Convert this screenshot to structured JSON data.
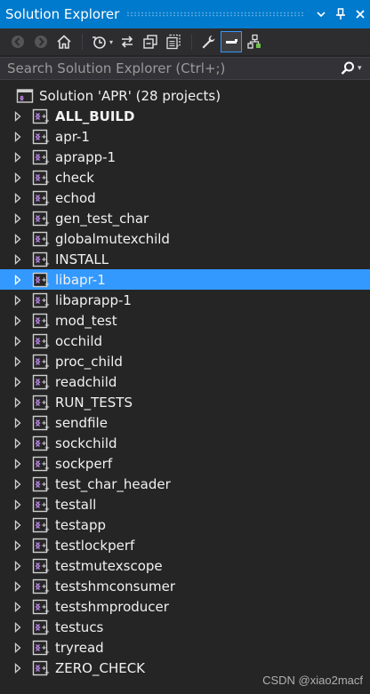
{
  "window": {
    "title": "Solution Explorer",
    "pin_icon": "pin-icon",
    "close_icon": "close-icon",
    "dropdown_icon": "chevron-down-icon"
  },
  "toolbar": {
    "icons": [
      "back-arrow-icon",
      "forward-arrow-icon",
      "home-icon",
      "history-icon",
      "sync-icon",
      "collapse-all-icon",
      "show-all-files-icon",
      "properties-wrench-icon",
      "preview-selected-icon",
      "class-view-icon"
    ]
  },
  "search": {
    "placeholder": "Search Solution Explorer (Ctrl+;)"
  },
  "solution": {
    "label": "Solution 'APR' (28 projects)"
  },
  "projects": [
    {
      "label": "ALL_BUILD",
      "bold": true,
      "selected": false
    },
    {
      "label": "apr-1",
      "bold": false,
      "selected": false
    },
    {
      "label": "aprapp-1",
      "bold": false,
      "selected": false
    },
    {
      "label": "check",
      "bold": false,
      "selected": false
    },
    {
      "label": "echod",
      "bold": false,
      "selected": false
    },
    {
      "label": "gen_test_char",
      "bold": false,
      "selected": false
    },
    {
      "label": "globalmutexchild",
      "bold": false,
      "selected": false
    },
    {
      "label": "INSTALL",
      "bold": false,
      "selected": false
    },
    {
      "label": "libapr-1",
      "bold": false,
      "selected": true
    },
    {
      "label": "libaprapp-1",
      "bold": false,
      "selected": false
    },
    {
      "label": "mod_test",
      "bold": false,
      "selected": false
    },
    {
      "label": "occhild",
      "bold": false,
      "selected": false
    },
    {
      "label": "proc_child",
      "bold": false,
      "selected": false
    },
    {
      "label": "readchild",
      "bold": false,
      "selected": false
    },
    {
      "label": "RUN_TESTS",
      "bold": false,
      "selected": false
    },
    {
      "label": "sendfile",
      "bold": false,
      "selected": false
    },
    {
      "label": "sockchild",
      "bold": false,
      "selected": false
    },
    {
      "label": "sockperf",
      "bold": false,
      "selected": false
    },
    {
      "label": "test_char_header",
      "bold": false,
      "selected": false
    },
    {
      "label": "testall",
      "bold": false,
      "selected": false
    },
    {
      "label": "testapp",
      "bold": false,
      "selected": false
    },
    {
      "label": "testlockperf",
      "bold": false,
      "selected": false
    },
    {
      "label": "testmutexscope",
      "bold": false,
      "selected": false
    },
    {
      "label": "testshmconsumer",
      "bold": false,
      "selected": false
    },
    {
      "label": "testshmproducer",
      "bold": false,
      "selected": false
    },
    {
      "label": "testucs",
      "bold": false,
      "selected": false
    },
    {
      "label": "tryread",
      "bold": false,
      "selected": false
    },
    {
      "label": "ZERO_CHECK",
      "bold": false,
      "selected": false
    }
  ],
  "watermark": "CSDN @xiao2macf",
  "colors": {
    "titlebar": "#007acc",
    "background": "#252526",
    "selection": "#3399ff",
    "text": "#f1f1f1"
  }
}
